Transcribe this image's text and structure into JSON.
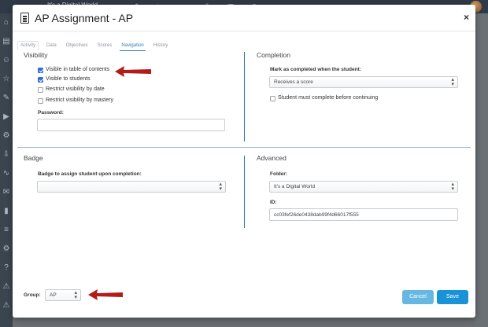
{
  "background": {
    "breadcrumb": "It's a Digital World"
  },
  "modal": {
    "title": "AP Assignment - AP",
    "close_glyph": "×",
    "tabs": [
      {
        "label": "Activity"
      },
      {
        "label": "Data"
      },
      {
        "label": "Objectives"
      },
      {
        "label": "Scores"
      },
      {
        "label": "Navigation",
        "active": true
      },
      {
        "label": "History"
      }
    ]
  },
  "visibility": {
    "title": "Visibility",
    "options": [
      {
        "label": "Visible in table of contents",
        "checked": true
      },
      {
        "label": "Visible to students",
        "checked": true
      },
      {
        "label": "Restrict visibility by date",
        "checked": false
      },
      {
        "label": "Restrict visibility by mastery",
        "checked": false
      }
    ],
    "password_label": "Password:",
    "password_value": ""
  },
  "completion": {
    "title": "Completion",
    "mark_label": "Mark as completed when the student:",
    "mark_value": "Receives a score",
    "must_complete_label": "Student must complete before continuing",
    "must_complete_checked": false
  },
  "badge": {
    "title": "Badge",
    "assign_label": "Badge to assign student upon completion:",
    "assign_value": ""
  },
  "advanced": {
    "title": "Advanced",
    "folder_label": "Folder:",
    "folder_value": "It's a Digital World",
    "id_label": "ID:",
    "id_value": "cc03fef26de0438dab99f4d66017f555"
  },
  "footer": {
    "group_label": "Group:",
    "group_value": "AP",
    "cancel_label": "Cancel",
    "save_label": "Save"
  },
  "colors": {
    "primary": "#1893d8",
    "cancel": "#66b8e2",
    "annotation_arrow": "#b31a1a",
    "divider": "#2e6fb5"
  }
}
